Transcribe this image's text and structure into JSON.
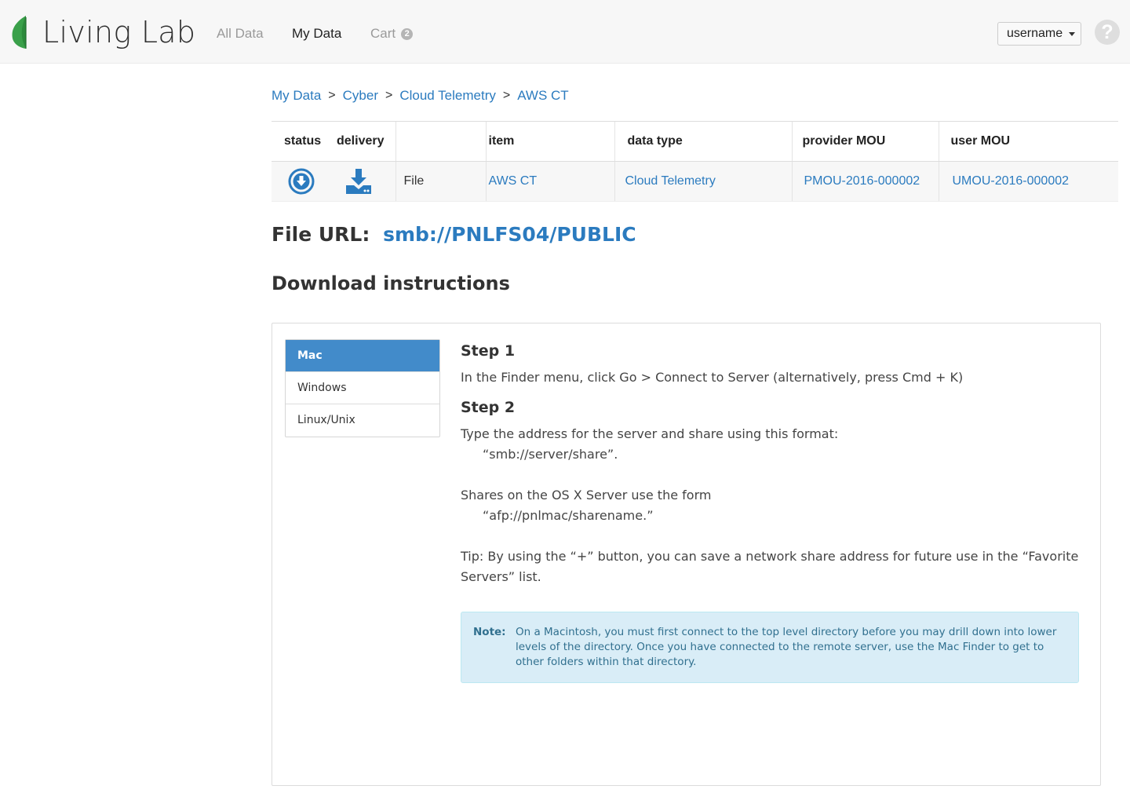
{
  "brand": {
    "name": "Living Lab"
  },
  "nav": {
    "all_data": "All Data",
    "my_data": "My Data",
    "cart": "Cart",
    "cart_count": "2"
  },
  "user_menu": {
    "label": "username"
  },
  "help": {
    "label": "?"
  },
  "breadcrumb": {
    "items": [
      "My Data",
      "Cyber",
      "Cloud Telemetry",
      "AWS CT"
    ],
    "separator": ">"
  },
  "table": {
    "headers": [
      "status",
      "delivery",
      "",
      "item",
      "data type",
      "provider MOU",
      "user MOU"
    ],
    "rows": [
      {
        "status_icon": "download-circle-icon",
        "delivery_icon": "download-drive-icon",
        "kind": "File",
        "item": "AWS CT",
        "data_type": "Cloud Telemetry",
        "provider_mou": "PMOU-2016-000002",
        "user_mou": "UMOU-2016-000002"
      }
    ]
  },
  "file_url": {
    "label": "File URL:",
    "value": "smb://PNLFS04/PUBLIC"
  },
  "download": {
    "heading": "Download instructions",
    "tabs": [
      "Mac",
      "Windows",
      "Linux/Unix"
    ],
    "active_tab": "Mac",
    "step1_title": "Step 1",
    "step1_text": "In the Finder menu, click Go > Connect to Server (alternatively, press Cmd + K)",
    "step2_title": "Step 2",
    "step2_line1": "Type the address for the server and share using this format:",
    "step2_line2": "“smb://server/share”.",
    "step2_line3": "Shares on the OS X Server use the form",
    "step2_line4": "“afp://pnlmac/sharename.”",
    "tip": "Tip: By using the “+” button, you can save a network share address for future use in the “Favorite Servers” list.",
    "note_label": "Note:",
    "note_text": "On a Macintosh, you must first connect to the top level directory before you may drill down into lower levels of the directory. Once you have connected to the remote server, use the Mac Finder to get to other folders within that directory."
  },
  "colors": {
    "accent": "#2b7bbf",
    "active_tab": "#428bca",
    "note_bg": "#d9edf7",
    "note_text": "#31708f",
    "leaf_green": "#3aa04a"
  }
}
